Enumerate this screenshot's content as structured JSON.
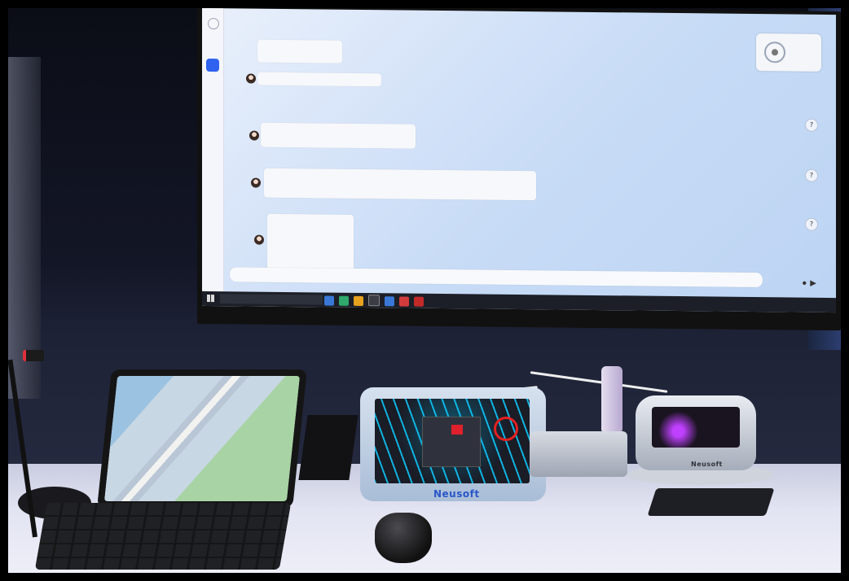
{
  "monitor": {
    "chat": {
      "assistant_messages": [
        "",
        "",
        "",
        ""
      ],
      "input_placeholder": ""
    },
    "widget": {
      "text": ""
    },
    "taskbar": {
      "search_text": "",
      "clock": ""
    }
  },
  "devices": {
    "center_brand": "Neusoft",
    "right_brand": "Neusoft"
  },
  "colors": {
    "user_bubble": "#2f5ee8",
    "brand_blue": "#2a57c8",
    "screen_bg": "#c7dbf6"
  },
  "icons": [
    "search-icon",
    "user-avatar-icon",
    "assistant-avatar-icon",
    "microphone-icon",
    "send-icon",
    "windows-start-icon"
  ]
}
